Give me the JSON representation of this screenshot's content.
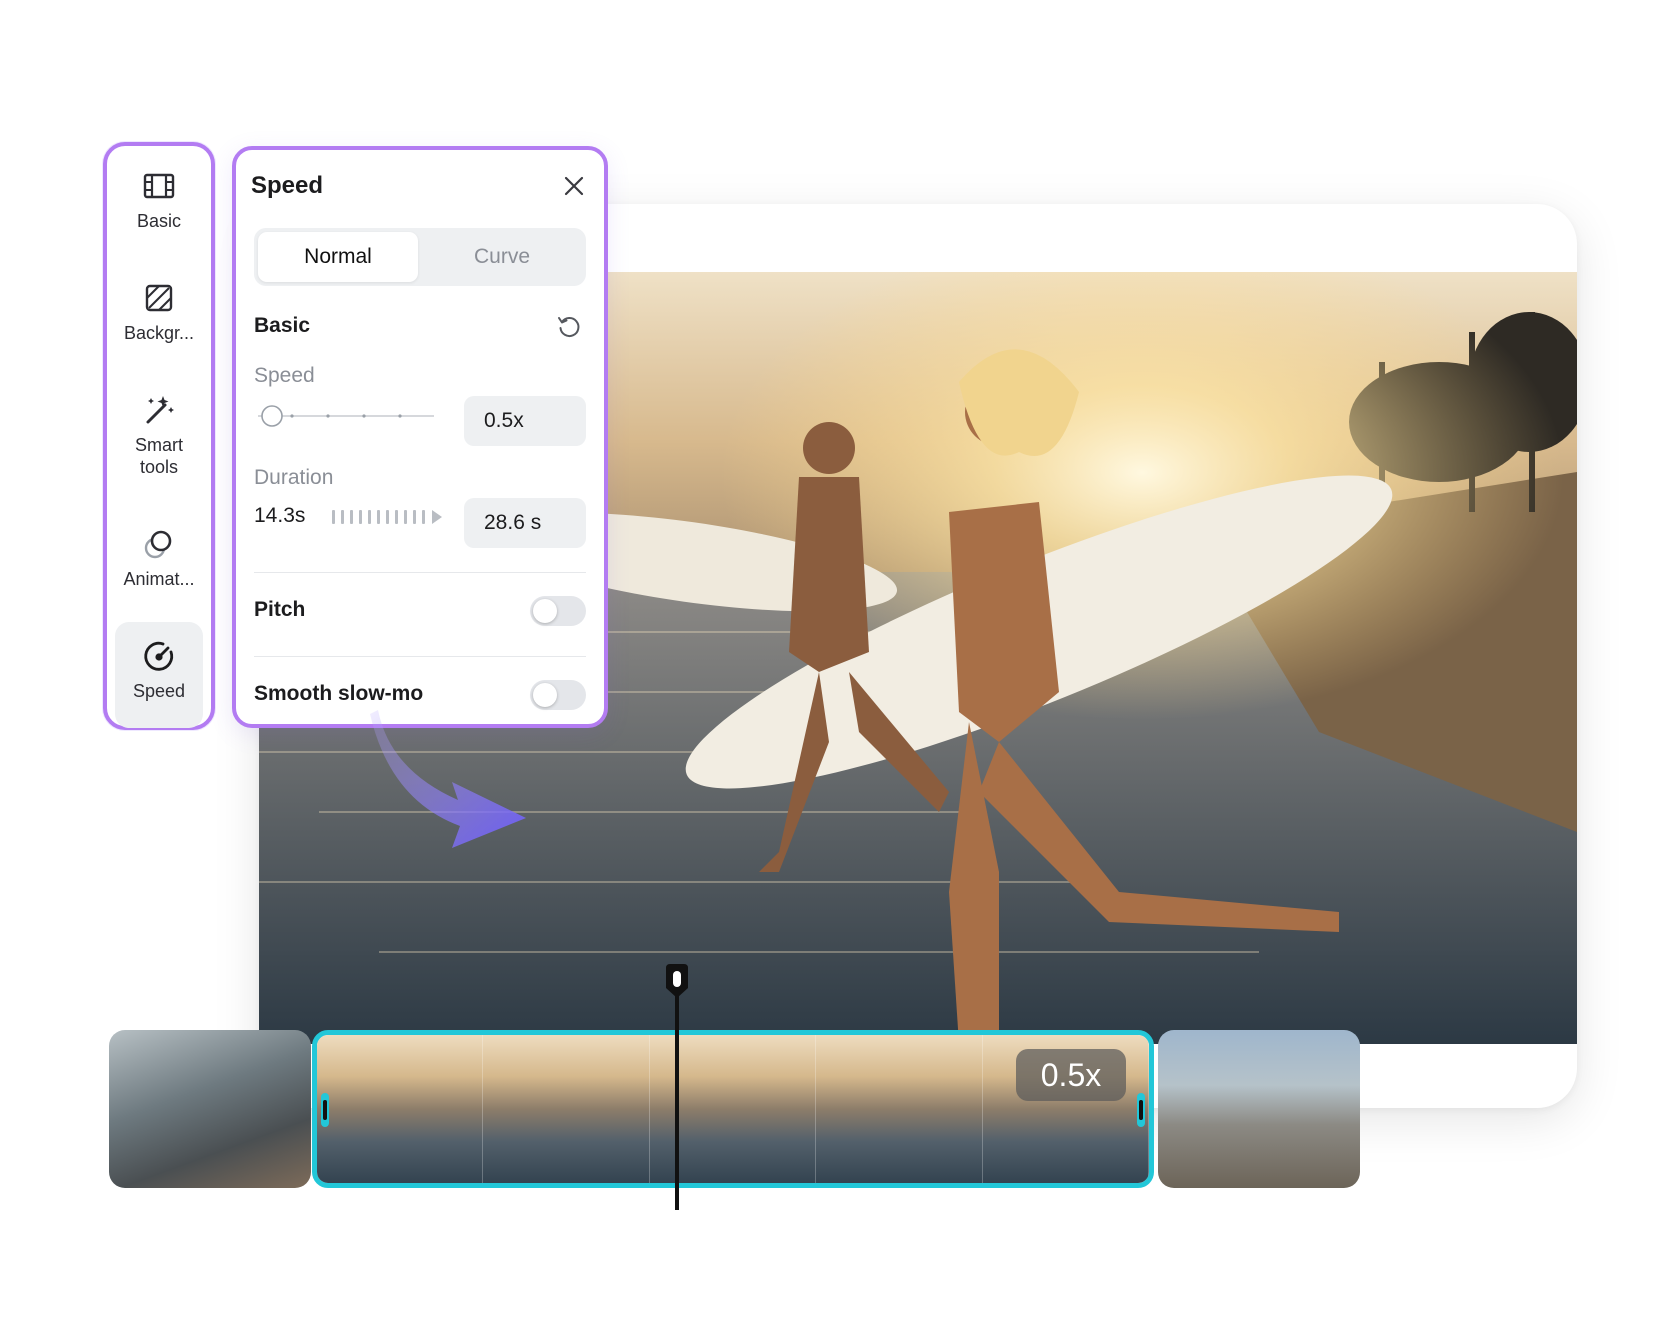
{
  "tool_rail": {
    "items": [
      {
        "label": "Basic",
        "icon": "film-icon"
      },
      {
        "label": "Backgr...",
        "icon": "background-icon"
      },
      {
        "label": "Smart\ntools",
        "icon": "magic-wand-icon"
      },
      {
        "label": "Animat...",
        "icon": "animation-icon"
      },
      {
        "label": "Speed",
        "icon": "speedometer-icon",
        "active": true
      }
    ]
  },
  "speed_panel": {
    "title": "Speed",
    "tabs": [
      {
        "label": "Normal",
        "selected": true
      },
      {
        "label": "Curve",
        "selected": false
      }
    ],
    "basic_section": {
      "title": "Basic",
      "speed_label": "Speed",
      "speed_value": "0.5x",
      "duration_label": "Duration",
      "duration_original": "14.3s",
      "duration_value": "28.6 s"
    },
    "pitch": {
      "label": "Pitch",
      "enabled": false
    },
    "smooth_slowmo": {
      "label": "Smooth slow-mo",
      "enabled": false
    }
  },
  "timeline": {
    "selected_clip_speed": "0.5x"
  },
  "colors": {
    "accent_purple": "#b37cf2",
    "arrow_purple": "#6b5cf5",
    "clip_selection": "#22c7d8"
  }
}
